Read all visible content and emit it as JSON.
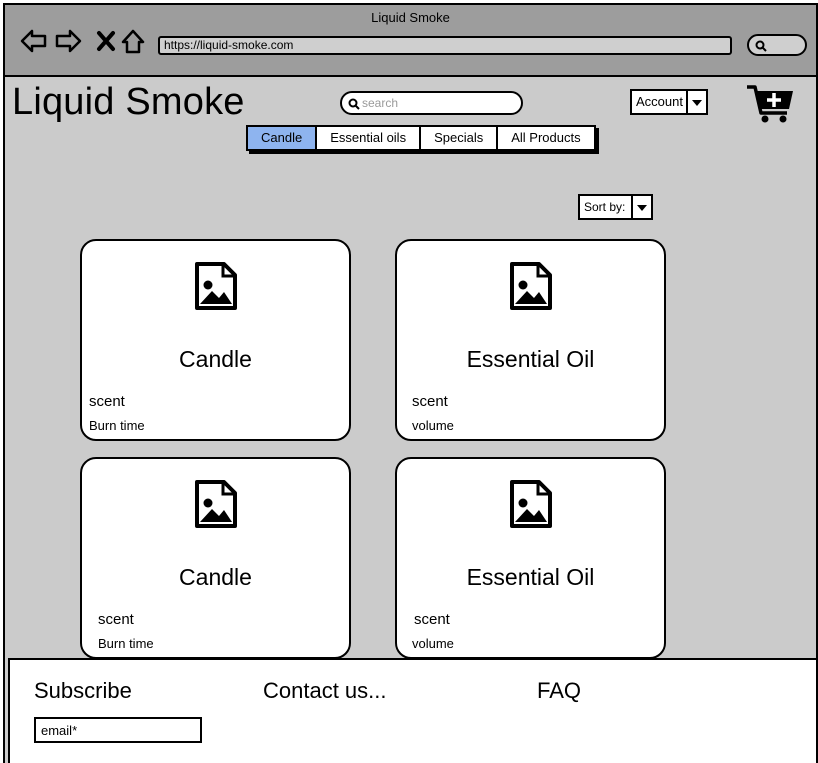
{
  "browser": {
    "window_title": "Liquid Smoke",
    "url": "https://liquid-smoke.com"
  },
  "header": {
    "logo": "Liquid Smoke",
    "search_placeholder": "search",
    "account_label": "Account"
  },
  "nav": {
    "tabs": [
      {
        "label": "Candle",
        "active": true
      },
      {
        "label": "Essential oils",
        "active": false
      },
      {
        "label": "Specials",
        "active": false
      },
      {
        "label": "All Products",
        "active": false
      }
    ]
  },
  "sort_label": "Sort by:",
  "products": [
    {
      "name": "Candle",
      "scent_label": "scent",
      "attribute_label": "Burn time"
    },
    {
      "name": "Essential Oil",
      "scent_label": "scent",
      "attribute_label": "volume"
    },
    {
      "name": "Candle",
      "scent_label": "scent",
      "attribute_label": "Burn time"
    },
    {
      "name": "Essential Oil",
      "scent_label": "scent",
      "attribute_label": "volume"
    }
  ],
  "footer": {
    "subscribe": "Subscribe",
    "email_placeholder": "email*",
    "contact": "Contact us...",
    "faq": "FAQ"
  },
  "colors": {
    "active_tab": "#8eb4ef",
    "chrome": "#9d9d9d",
    "page_background": "#cbcbcb"
  },
  "icons": [
    "back-arrow-icon",
    "forward-arrow-icon",
    "close-icon",
    "home-icon",
    "search-icon",
    "cart-add-icon",
    "image-placeholder-icon",
    "chevron-down-icon"
  ]
}
